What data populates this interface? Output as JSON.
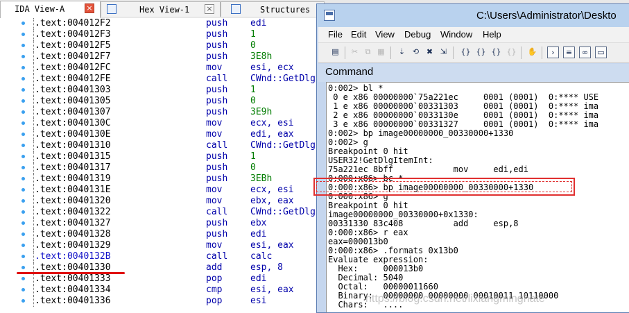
{
  "ida": {
    "tabs": [
      {
        "label": "IDA View-A",
        "close": "×"
      },
      {
        "label": "Hex View-1",
        "close": "×"
      },
      {
        "label": "Structures",
        "close": ""
      }
    ],
    "listing": [
      {
        "addr": ".text:004012F2",
        "mnem": "push",
        "op": "edi"
      },
      {
        "addr": ".text:004012F3",
        "mnem": "push",
        "op": "1"
      },
      {
        "addr": ".text:004012F5",
        "mnem": "push",
        "op": "0"
      },
      {
        "addr": ".text:004012F7",
        "mnem": "push",
        "op": "3E8h"
      },
      {
        "addr": ".text:004012FC",
        "mnem": "mov",
        "op": "esi, ecx"
      },
      {
        "addr": ".text:004012FE",
        "mnem": "call",
        "op": "CWnd::GetDlg"
      },
      {
        "addr": ".text:00401303",
        "mnem": "push",
        "op": "1"
      },
      {
        "addr": ".text:00401305",
        "mnem": "push",
        "op": "0"
      },
      {
        "addr": ".text:00401307",
        "mnem": "push",
        "op": "3E9h"
      },
      {
        "addr": ".text:0040130C",
        "mnem": "mov",
        "op": "ecx, esi"
      },
      {
        "addr": ".text:0040130E",
        "mnem": "mov",
        "op": "edi, eax"
      },
      {
        "addr": ".text:00401310",
        "mnem": "call",
        "op": "CWnd::GetDlg"
      },
      {
        "addr": ".text:00401315",
        "mnem": "push",
        "op": "1"
      },
      {
        "addr": ".text:00401317",
        "mnem": "push",
        "op": "0"
      },
      {
        "addr": ".text:00401319",
        "mnem": "push",
        "op": "3EBh"
      },
      {
        "addr": ".text:0040131E",
        "mnem": "mov",
        "op": "ecx, esi"
      },
      {
        "addr": ".text:00401320",
        "mnem": "mov",
        "op": "ebx, eax"
      },
      {
        "addr": ".text:00401322",
        "mnem": "call",
        "op": "CWnd::GetDlg"
      },
      {
        "addr": ".text:00401327",
        "mnem": "push",
        "op": "ebx"
      },
      {
        "addr": ".text:00401328",
        "mnem": "push",
        "op": "edi"
      },
      {
        "addr": ".text:00401329",
        "mnem": "mov",
        "op": "esi, eax"
      },
      {
        "addr": ".text:0040132B",
        "mnem": "call",
        "op": "calc"
      },
      {
        "addr": ".text:00401330",
        "mnem": "add",
        "op": "esp, 8"
      },
      {
        "addr": ".text:00401333",
        "mnem": "pop",
        "op": "edi"
      },
      {
        "addr": ".text:00401334",
        "mnem": "cmp",
        "op": "esi, eax"
      },
      {
        "addr": ".text:00401336",
        "mnem": "pop",
        "op": "esi"
      }
    ]
  },
  "windbg": {
    "title": "C:\\Users\\Administrator\\Deskto",
    "menu": [
      "File",
      "Edit",
      "View",
      "Debug",
      "Window",
      "Help"
    ],
    "command_title": "Command",
    "console": [
      "0:002> bl *",
      " 0 e x86 00000000`75a221ec     0001 (0001)  0:**** USE",
      " 1 e x86 00000000`00331303     0001 (0001)  0:**** ima",
      " 2 e x86 00000000`0033130e     0001 (0001)  0:**** ima",
      " 3 e x86 00000000`00331327     0001 (0001)  0:**** ima",
      "0:002> bp image00000000_00330000+1330",
      "0:002> g",
      "Breakpoint 0 hit",
      "USER32!GetDlgItemInt:",
      "75a221ec 8bff            mov     edi,edi",
      "0:000:x86> bc *",
      "0:000:x86> bp image00000000_00330000+1330",
      "0:000:x86> g",
      "Breakpoint 0 hit",
      "image00000000_00330000+0x1330:",
      "00331330 83c408          add     esp,8",
      "0:000:x86> r eax",
      "eax=000013b0",
      "0:000:x86> .formats 0x13b0",
      "Evaluate expression:",
      "  Hex:     000013b0",
      "  Decimal: 5040",
      "  Octal:   00000011660",
      "  Binary:  00000000 00000000 00010011 10110000",
      "  Chars:   ...."
    ]
  },
  "watermark": "https://blog.csdn.net/lixiangminghate"
}
